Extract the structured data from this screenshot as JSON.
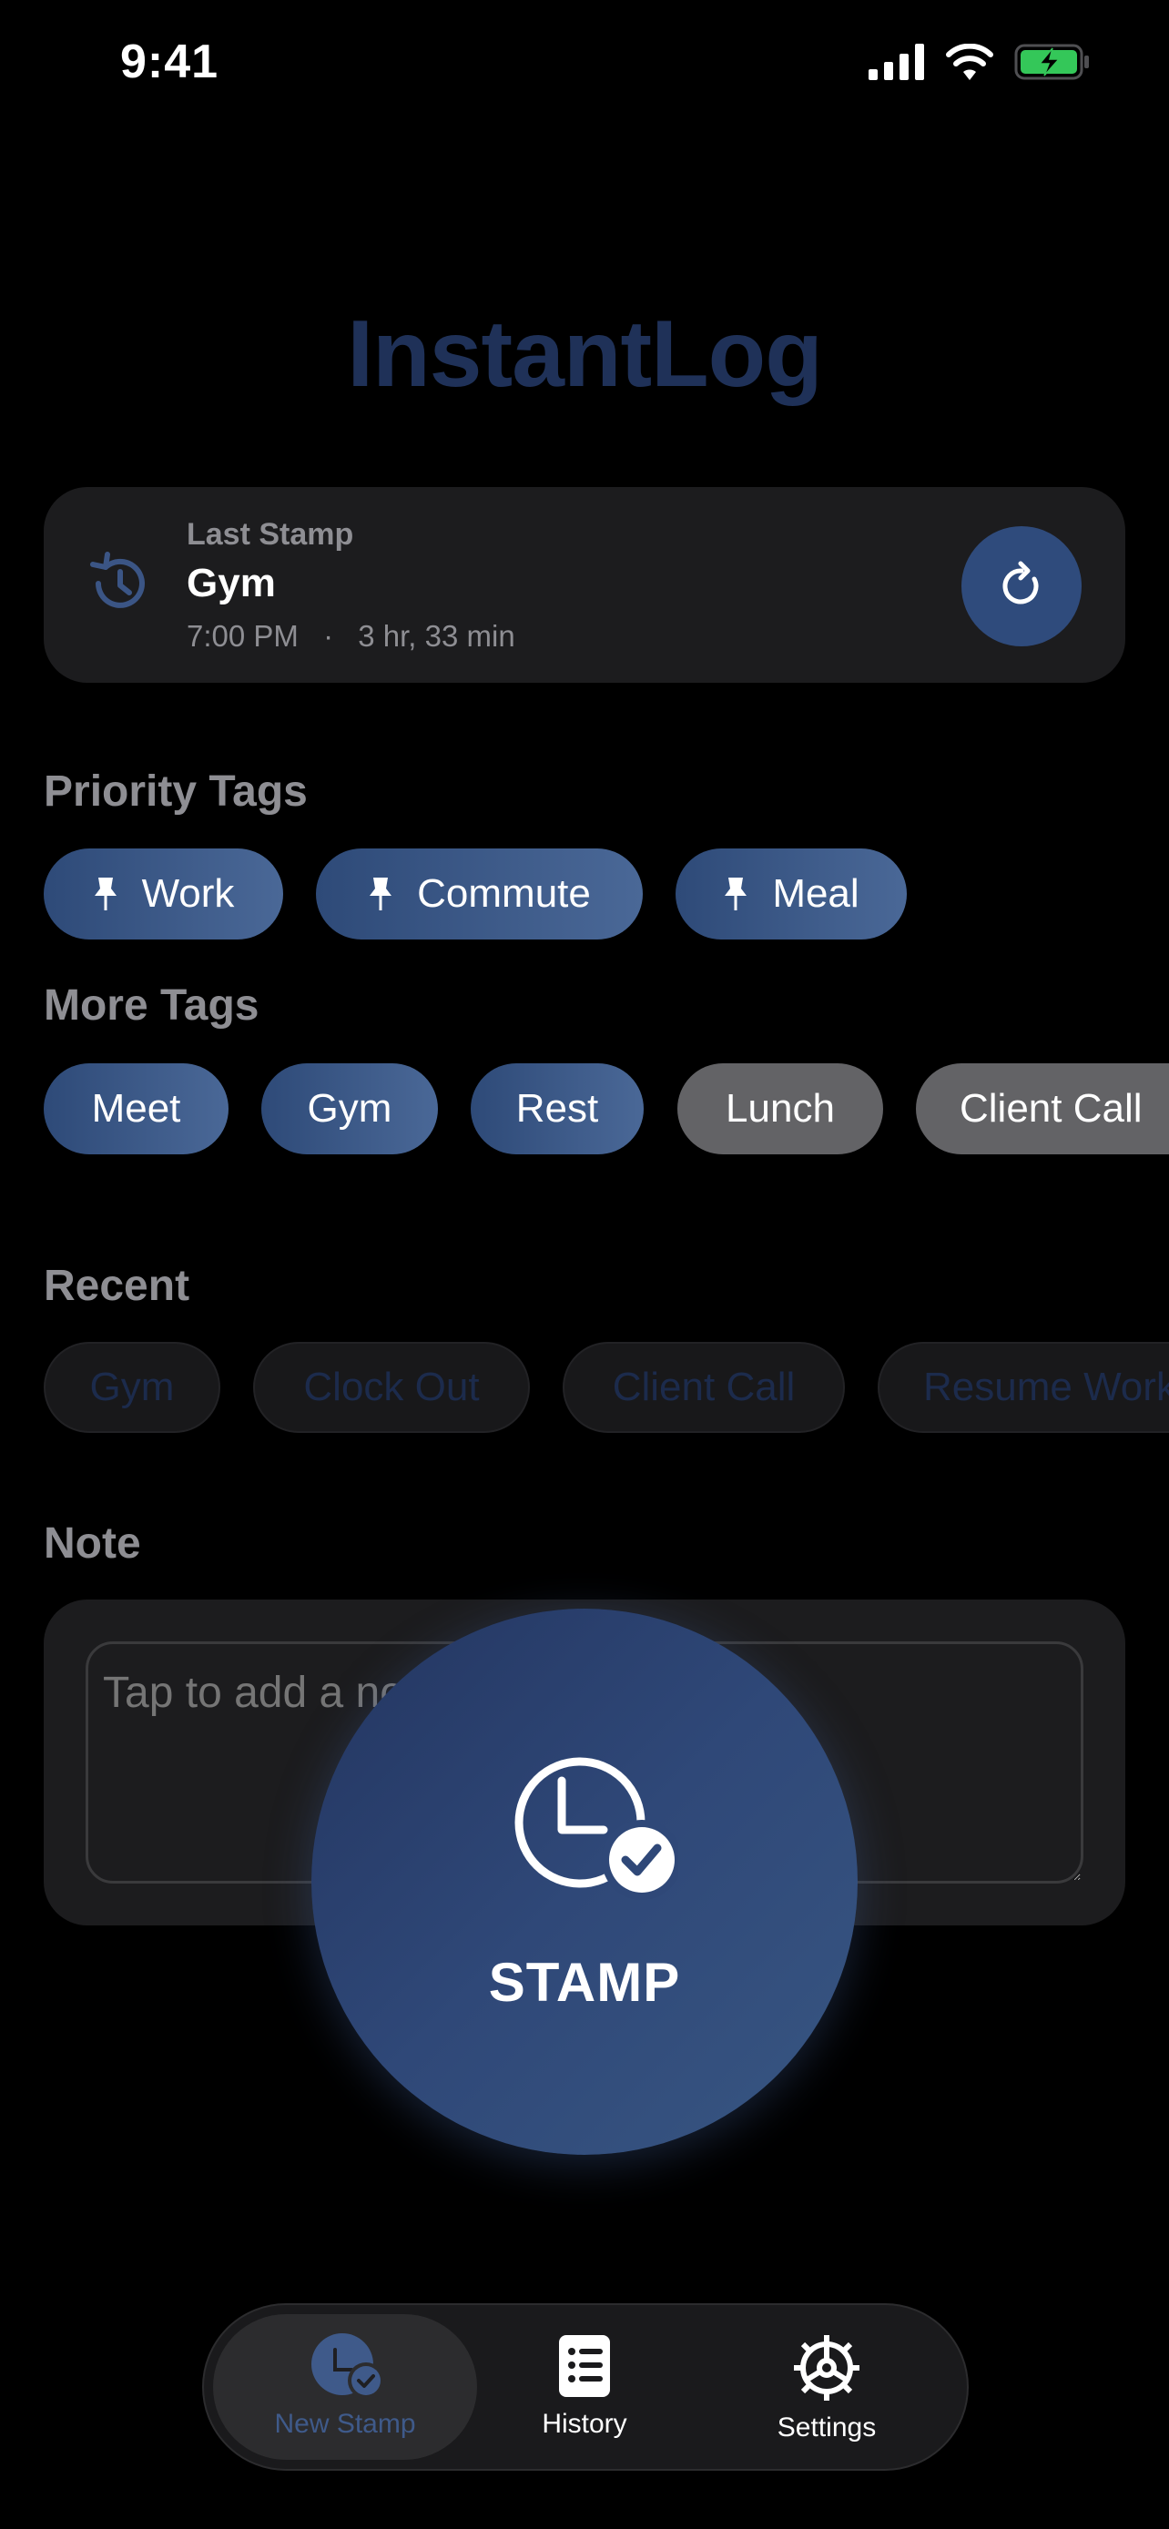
{
  "status": {
    "time": "9:41",
    "icons": [
      "signal-icon",
      "wifi-icon",
      "battery-charging-icon"
    ]
  },
  "app": {
    "title": "InstantLog"
  },
  "last_stamp": {
    "label": "Last Stamp",
    "name": "Gym",
    "time": "7:00 PM",
    "separator": "·",
    "duration": "3 hr, 33 min",
    "icon": "history-icon",
    "repeat_icon": "repeat-icon"
  },
  "priority_tags": {
    "title": "Priority Tags",
    "items": [
      {
        "label": "Work",
        "icon": "pin-icon"
      },
      {
        "label": "Commute",
        "icon": "pin-icon"
      },
      {
        "label": "Meal",
        "icon": "pin-icon"
      }
    ]
  },
  "more_tags": {
    "title": "More Tags",
    "items": [
      "Meet",
      "Gym",
      "Rest",
      "Lunch",
      "Client Call"
    ]
  },
  "recent": {
    "title": "Recent",
    "items": [
      "Gym",
      "Clock Out",
      "Client Call",
      "Resume Work"
    ]
  },
  "note": {
    "title": "Note",
    "placeholder": "Tap to add a note"
  },
  "stamp": {
    "label": "STAMP",
    "icon": "clock-check-icon"
  },
  "tabs": [
    {
      "label": "New Stamp",
      "icon": "clock-check-icon",
      "active": true
    },
    {
      "label": "History",
      "icon": "list-icon",
      "active": false
    },
    {
      "label": "Settings",
      "icon": "gear-icon",
      "active": false
    }
  ],
  "colors": {
    "accent": "#2f4b7c",
    "title": "#1f3158",
    "card": "#1c1c1e",
    "muted": "#8e8e93",
    "battery": "#34c759"
  }
}
